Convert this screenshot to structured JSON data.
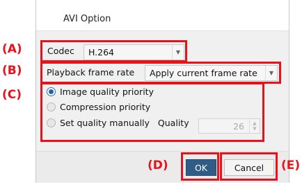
{
  "dialog": {
    "title": "AVI Option",
    "codec": {
      "label": "Codec",
      "value": "H.264"
    },
    "playback": {
      "label": "Playback frame rate",
      "value": "Apply current frame rate"
    },
    "quality_options": [
      {
        "label": "Image quality priority",
        "checked": true
      },
      {
        "label": "Compression priority",
        "checked": false
      },
      {
        "label": "Set quality manually",
        "checked": false
      }
    ],
    "quality": {
      "label": "Quality",
      "value": "26"
    },
    "buttons": {
      "ok": "OK",
      "cancel": "Cancel"
    }
  },
  "annotations": {
    "a": "(A)",
    "b": "(B)",
    "c": "(C)",
    "d": "(D)",
    "e": "(E)",
    "color": "#e8121a"
  },
  "colors": {
    "ok_button": "#2f5d87",
    "radio_selected": "#2563a8"
  }
}
